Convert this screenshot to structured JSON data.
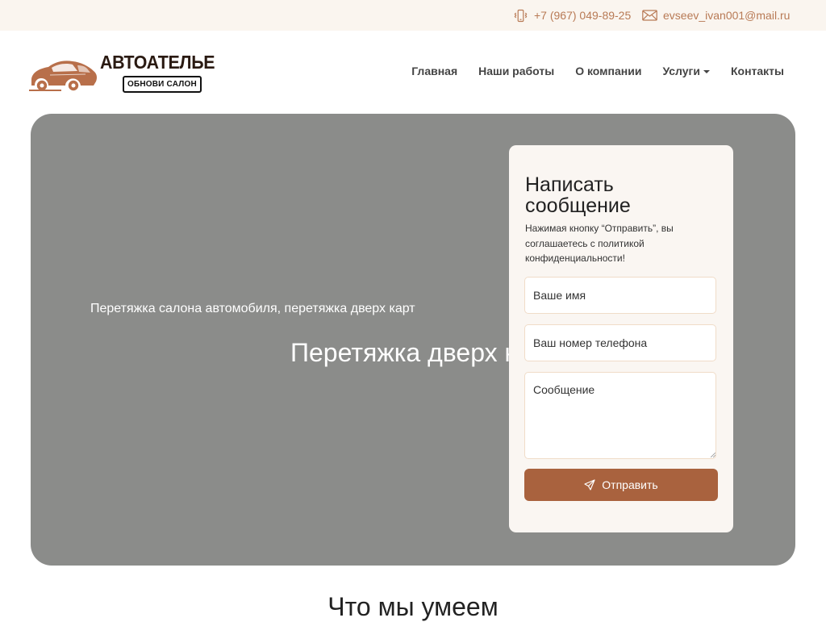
{
  "topbar": {
    "phone": "+7 (967) 049-89-25",
    "email": "evseev_ivan001@mail.ru"
  },
  "logo": {
    "title": "АВТОАТЕЛЬЕ",
    "subtitle": "ОБНОВИ САЛОН"
  },
  "nav": {
    "items": [
      "Главная",
      "Наши работы",
      "О компании",
      "Услуги",
      "Контакты"
    ]
  },
  "hero": {
    "subtitle": "Перетяжка салона автомобиля, перетяжка дверх карт",
    "title": "Перетяжка дверх карт"
  },
  "form": {
    "title": "Написать сообщение",
    "note": "Нажимая кнопку “Отправить”, вы соглашаетесь с политикой конфиденциальности!",
    "name_placeholder": "Ваше имя",
    "phone_placeholder": "Ваш номер телефона",
    "message_placeholder": "Сообщение",
    "submit_label": "Отправить"
  },
  "section": {
    "title": "Что мы умеем"
  },
  "colors": {
    "accent": "#a9623e",
    "link": "#b87a55",
    "topbar_bg": "#faf5ef",
    "hero_bg": "#8b8c8a"
  },
  "icons": {
    "phone": "phone-vibrate-icon",
    "email": "envelope-icon",
    "submit": "send-icon"
  }
}
